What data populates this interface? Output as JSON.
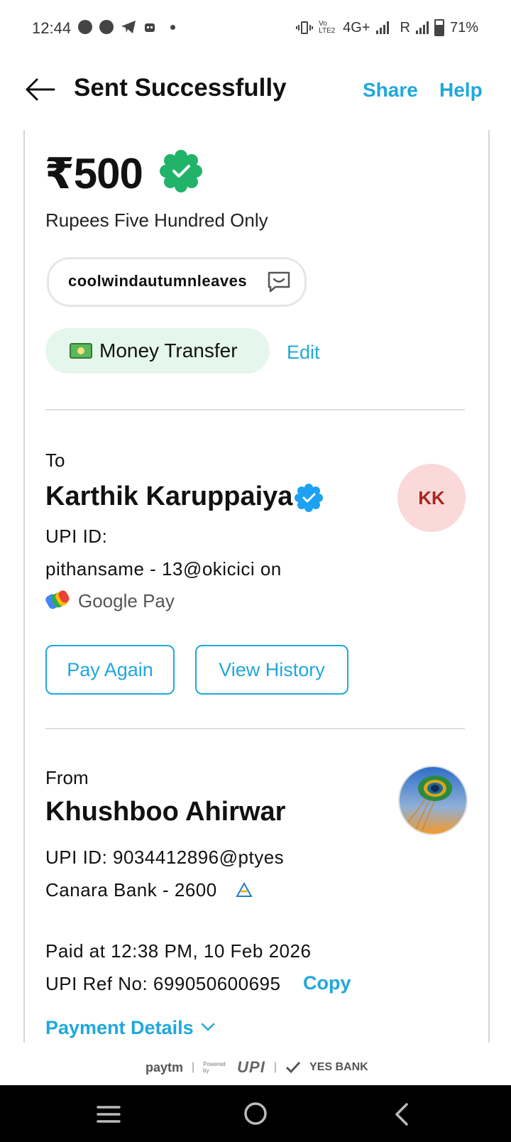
{
  "status_bar": {
    "time": "12:44",
    "network_label": "4G+",
    "roaming_label": "R",
    "battery": "71%",
    "volte_label": "Vo LTE2"
  },
  "header": {
    "title": "Sent Successfully",
    "share_label": "Share",
    "help_label": "Help"
  },
  "payment": {
    "amount": "₹500",
    "amount_words": "Rupees Five Hundred Only",
    "note": "coolwindautumnleaves",
    "category": "Money Transfer",
    "edit_label": "Edit"
  },
  "to": {
    "label": "To",
    "name": "Karthik Karuppaiya",
    "initials": "KK",
    "upi_label": "UPI ID:",
    "upi_id": "pithansame - 13@okicici on",
    "app_name": "Google Pay",
    "pay_again_label": "Pay Again",
    "view_history_label": "View History"
  },
  "from": {
    "label": "From",
    "name": "Khushboo Ahirwar",
    "upi_id": "UPI ID: 9034412896@ptyes",
    "bank": "Canara Bank - 2600",
    "paid_at": "Paid at 12:38 PM, 10 Feb 2026",
    "upi_ref": "UPI Ref No: 699050600695",
    "copy_label": "Copy",
    "payment_details_label": "Payment Details"
  },
  "footer": {
    "paytm": "paytm",
    "powered_by": "Powered by",
    "upi": "UPI",
    "bank": "YES BANK"
  },
  "colors": {
    "accent": "#1fa8db",
    "verified_green": "#22b36b",
    "verified_blue": "#1da1f2",
    "chip_bg": "#e5f6ec",
    "avatar_bg": "#fbd9d9"
  }
}
